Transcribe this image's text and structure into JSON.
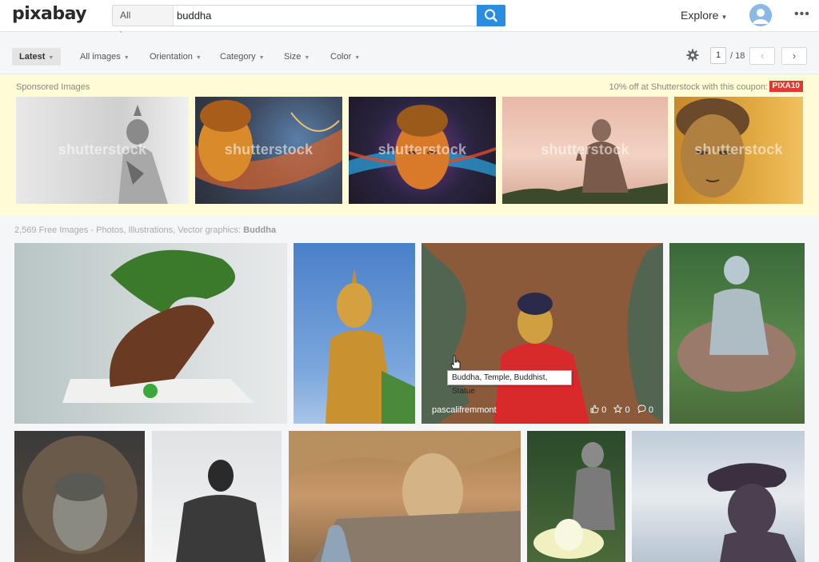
{
  "header": {
    "logo": "pixabay",
    "search_type": "All images",
    "search_value": "buddha",
    "explore": "Explore",
    "more": "•••"
  },
  "filters": {
    "sort": "Latest",
    "type": "All images",
    "orientation": "Orientation",
    "category": "Category",
    "size": "Size",
    "color": "Color",
    "page_current": "1",
    "page_total": "/ 18",
    "prev": "‹",
    "next": "›"
  },
  "sponsored": {
    "label": "Sponsored Images",
    "coupon_text": "10% off at Shutterstock with this coupon:",
    "coupon_code": "PIXA10",
    "watermark": "shutterstock"
  },
  "results": {
    "count_text": "2,569 Free Images - Photos, Illustrations, Vector graphics:",
    "query": "Buddha",
    "hover_tooltip": "Buddha, Temple, Buddhist, Statue",
    "hover_author": "pascalifremmont",
    "hover_likes": "0",
    "hover_favorites": "0",
    "hover_comments": "0"
  },
  "colors": {
    "accent": "#2b8de0",
    "coupon": "#e03a2f",
    "sponsored_bg": "#fefcd6"
  }
}
